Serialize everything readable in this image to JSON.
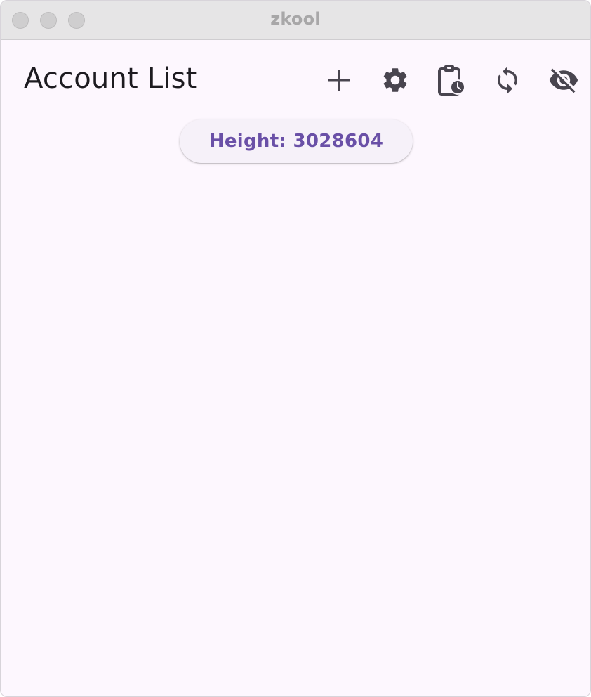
{
  "window": {
    "title": "zkool"
  },
  "appbar": {
    "title": "Account List",
    "actions": [
      {
        "icon": "add-icon"
      },
      {
        "icon": "gear-icon"
      },
      {
        "icon": "clipboard-clock-icon"
      },
      {
        "icon": "sync-icon"
      },
      {
        "icon": "eye-off-icon"
      }
    ]
  },
  "status": {
    "height_label": "Height: 3028604"
  },
  "colors": {
    "background": "#fdf7fe",
    "icon": "#49454f",
    "accent": "#6a50a7",
    "chip_background": "#f6f1f9"
  },
  "accounts": []
}
